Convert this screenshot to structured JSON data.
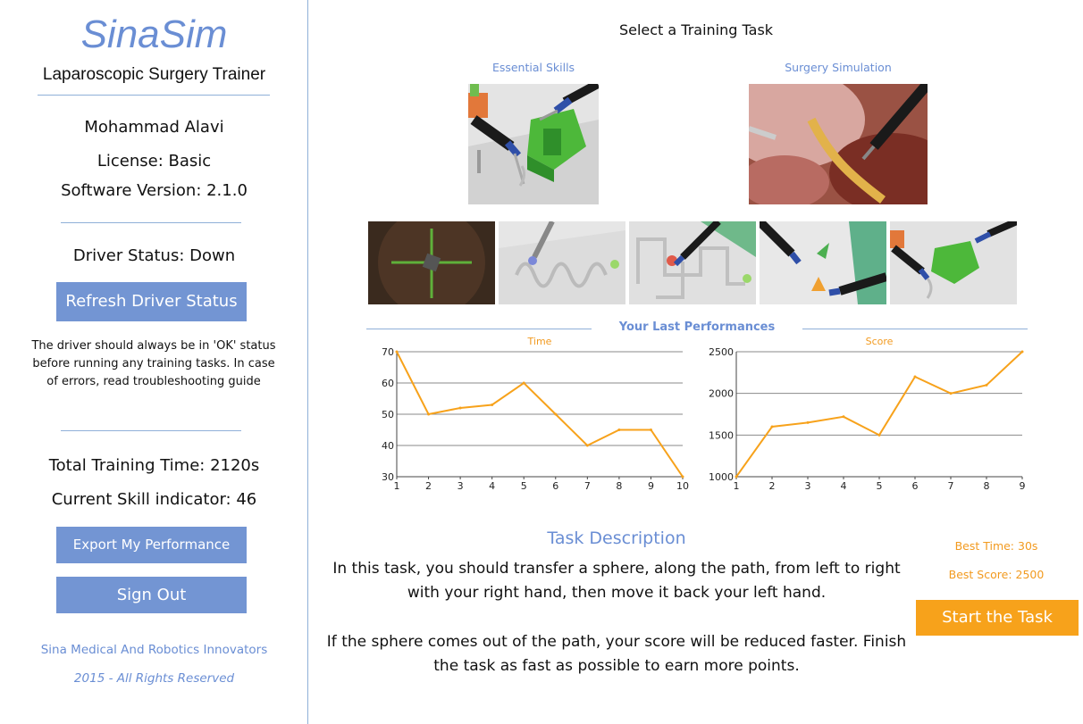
{
  "sidebar": {
    "app_title": "SinaSim",
    "app_subtitle": "Laparoscopic Surgery Trainer",
    "user_name": "Mohammad Alavi",
    "license": "License: Basic",
    "version": "Software Version: 2.1.0",
    "driver_status": "Driver Status: Down",
    "refresh_label": "Refresh Driver Status",
    "driver_note": "The driver should always be in 'OK' status before running any training tasks. In case of errors, read troubleshooting guide",
    "total_time": "Total Training Time: 2120s",
    "skill_indicator": "Current Skill indicator: 46",
    "export_label": "Export My Performance",
    "signout_label": "Sign Out",
    "company": "Sina Medical And Robotics Innovators",
    "copyright": "2015 - All Rights Reserved"
  },
  "main": {
    "title": "Select a Training Task",
    "categories": [
      {
        "label": "Essential Skills",
        "icon": "essential-skills-thumbnail"
      },
      {
        "label": "Surgery Simulation",
        "icon": "surgery-simulation-thumbnail"
      }
    ],
    "tasks": [
      {
        "icon": "camera-target-task"
      },
      {
        "icon": "wire-path-task"
      },
      {
        "icon": "maze-path-task"
      },
      {
        "icon": "arrow-transfer-task"
      },
      {
        "icon": "peg-transfer-task"
      }
    ],
    "performance_title": "Your Last Performances",
    "task_description_title": "Task Description",
    "task_description_1": "In this task, you should transfer a sphere, along the path, from left to right with your right hand, then move it back your left hand.",
    "task_description_2": "If the sphere comes out of the path, your score will be reduced faster. Finish the task as fast as possible to earn more points.",
    "best_time": "Best Time: 30s",
    "best_score": "Best Score: 2500",
    "start_label": "Start the Task"
  },
  "colors": {
    "accent": "#7395d3",
    "accent_text": "#6a8ed4",
    "orange": "#f7a21b"
  },
  "chart_data": [
    {
      "type": "line",
      "title": "Time",
      "x": [
        1,
        2,
        3,
        4,
        5,
        6,
        7,
        8,
        9,
        10
      ],
      "values": [
        70,
        50,
        52,
        53,
        60,
        50,
        40,
        45,
        45,
        30
      ],
      "ylim": [
        30,
        70
      ],
      "yticks": [
        30,
        40,
        50,
        60,
        70
      ],
      "xticks": [
        1,
        2,
        3,
        4,
        5,
        6,
        7,
        8,
        9,
        10
      ],
      "grid": true,
      "color": "#f7a21b"
    },
    {
      "type": "line",
      "title": "Score",
      "x": [
        1,
        2,
        3,
        4,
        5,
        6,
        7,
        8,
        9
      ],
      "values": [
        1000,
        1600,
        1650,
        1720,
        1500,
        2200,
        2000,
        2100,
        2500
      ],
      "ylim": [
        1000,
        2500
      ],
      "yticks": [
        1000,
        1500,
        2000,
        2500
      ],
      "xticks": [
        1,
        2,
        3,
        4,
        5,
        6,
        7,
        8,
        9
      ],
      "grid": true,
      "color": "#f7a21b"
    }
  ]
}
